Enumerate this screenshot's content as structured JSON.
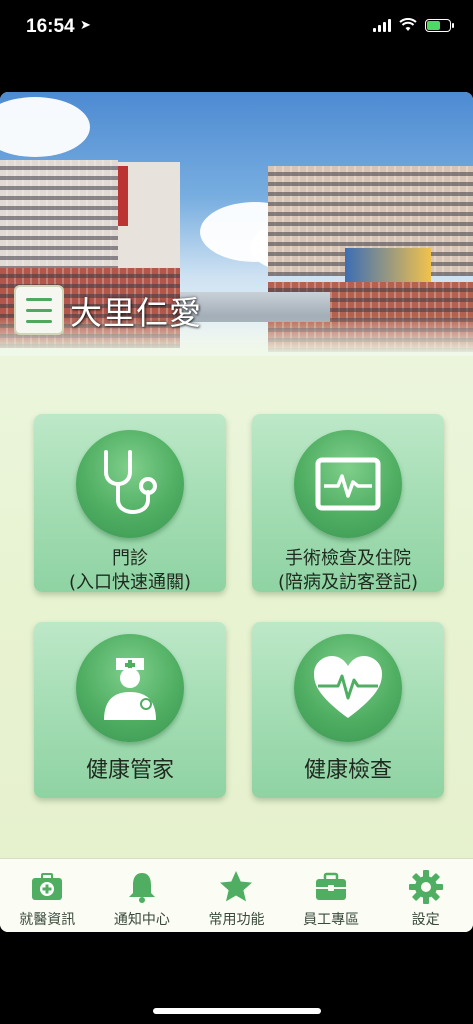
{
  "status_bar": {
    "time": "16:54",
    "location_icon": "location-arrow-icon"
  },
  "header": {
    "brand": "大里仁愛",
    "menu_icon": "hamburger-menu-icon"
  },
  "tiles": [
    {
      "line1": "門診",
      "line2": "(入口快速通關)",
      "icon": "stethoscope-icon"
    },
    {
      "line1": "手術檢查及住院",
      "line2": "(陪病及訪客登記)",
      "icon": "heart-monitor-icon"
    },
    {
      "line1": "健康管家",
      "icon": "doctor-icon"
    },
    {
      "line1": "健康檢查",
      "icon": "heart-pulse-icon"
    }
  ],
  "tabbar": [
    {
      "label": "就醫資訊",
      "icon": "medical-kit-icon"
    },
    {
      "label": "通知中心",
      "icon": "bell-icon"
    },
    {
      "label": "常用功能",
      "icon": "star-icon"
    },
    {
      "label": "員工專區",
      "icon": "briefcase-icon"
    },
    {
      "label": "設定",
      "icon": "gear-icon"
    }
  ],
  "colors": {
    "accent": "#4fae62",
    "tile": "#a6deb5",
    "background": "#eef6e0"
  }
}
